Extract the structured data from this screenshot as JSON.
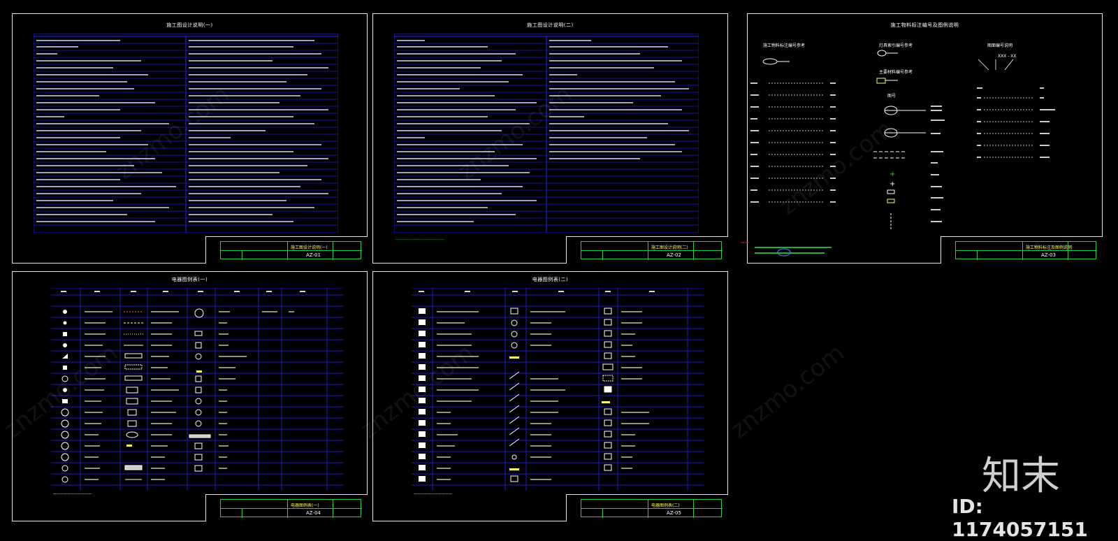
{
  "sheets": [
    {
      "title": "施工图设计说明(一)",
      "code": "AZ-01",
      "name": "施工图设计说明(一)"
    },
    {
      "title": "施工图设计说明(二)",
      "code": "AZ-02",
      "name": "施工图设计说明(二)"
    },
    {
      "title": "施工物料标注编号及图例说明",
      "code": "AZ-03",
      "name": "施工物料标注及图例说明"
    },
    {
      "title": "电器图例表(一)",
      "code": "AZ-04",
      "name": "电器图例表(一)"
    },
    {
      "title": "电器图例表(二)",
      "code": "AZ-05",
      "name": "电器图例表(二)"
    }
  ],
  "legend_sheet": {
    "section_a": "施工物料标注编号参考",
    "section_b": "灯具索引编号参考",
    "section_c": "主要材料编号参考",
    "section_d": "图号",
    "section_e": "图面编号说明",
    "code_pattern": "XXX - XX"
  },
  "brand": {
    "logo": "知末",
    "id_label": "ID: 1174057151",
    "watermark": "znzmo.com"
  }
}
